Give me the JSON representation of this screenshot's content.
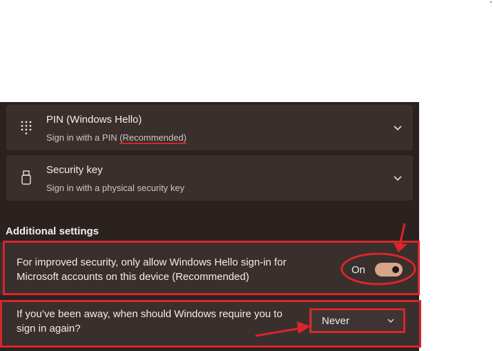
{
  "sign_in_options": {
    "pin": {
      "title": "PIN (Windows Hello)",
      "subtitle_prefix": "Sign in with a PIN ",
      "subtitle_emphasis": "(Recommended)",
      "icon": "keypad-icon"
    },
    "security_key": {
      "title": "Security key",
      "subtitle": "Sign in with a physical security key",
      "icon": "usb-key-icon"
    }
  },
  "additional_settings": {
    "heading": "Additional settings",
    "hello_only": {
      "line1": "For improved security, only allow Windows Hello sign-in for",
      "line2": "Microsoft accounts on this device (Recommended)",
      "toggle_label": "On",
      "toggle_state": true
    },
    "require_signin": {
      "line1": "If you’ve been away, when should Windows require you to",
      "line2": "sign in again?",
      "selected": "Never"
    }
  },
  "colors": {
    "panel_bg": "#2b2220",
    "card_bg": "#392f2c",
    "accent": "#d7a58a",
    "annotation_red": "#d8262b"
  }
}
